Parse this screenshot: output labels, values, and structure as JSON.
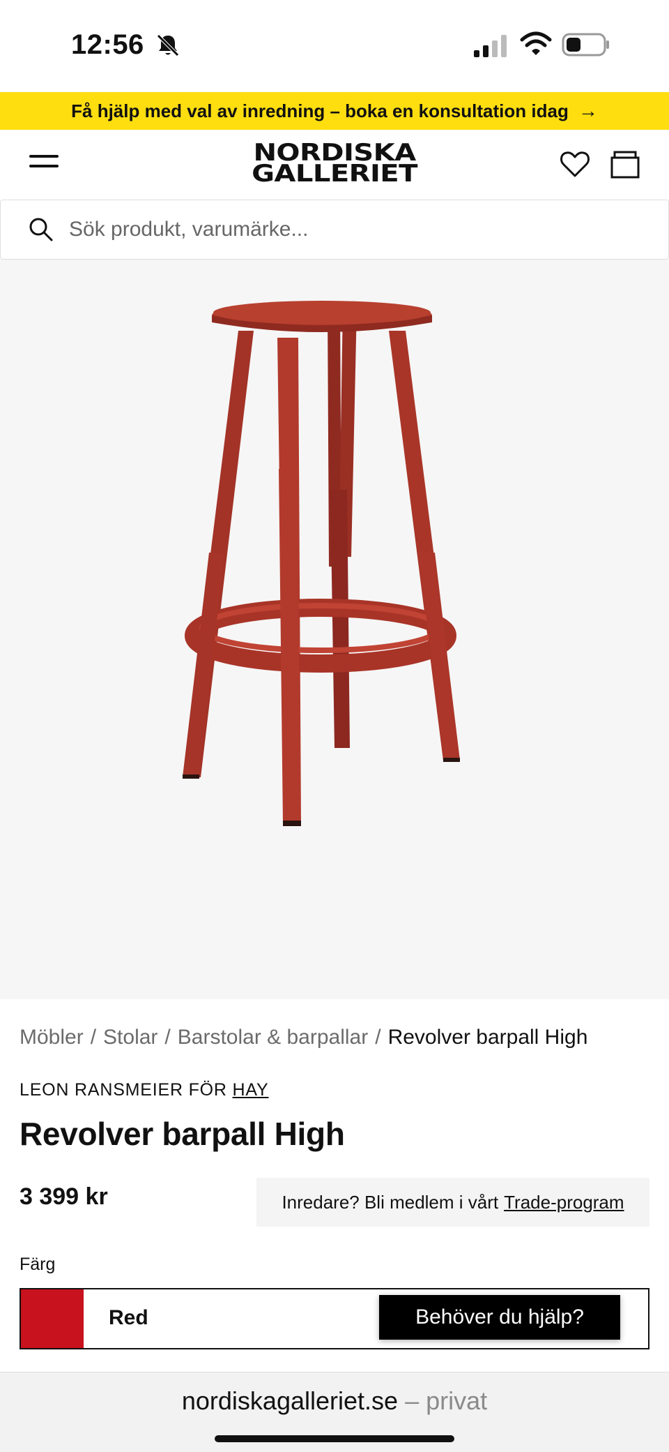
{
  "status_bar": {
    "time": "12:56"
  },
  "promo": {
    "text": "Få hjälp med val av inredning – boka en konsultation idag",
    "arrow": "→"
  },
  "header": {
    "logo_line1": "NORDISKA",
    "logo_line2": "GALLERIET"
  },
  "search": {
    "placeholder": "Sök produkt, varumärke..."
  },
  "breadcrumb": {
    "items": [
      "Möbler",
      "Stolar",
      "Barstolar & barpallar"
    ],
    "current": "Revolver barpall High",
    "separator": "/"
  },
  "product": {
    "designer_prefix": "LEON RANSMEIER FÖR",
    "brand": "HAY",
    "title": "Revolver barpall High",
    "price": "3 399 kr",
    "image_color": "#a8362a"
  },
  "trade": {
    "text": "Inredare? Bli medlem i vårt",
    "link": "Trade-program"
  },
  "color": {
    "label": "Färg",
    "value": "Red",
    "swatch": "#c8121e"
  },
  "help": {
    "label": "Behöver du hjälp?"
  },
  "browser": {
    "domain": "nordiskagalleriet.se",
    "suffix": "– privat"
  }
}
